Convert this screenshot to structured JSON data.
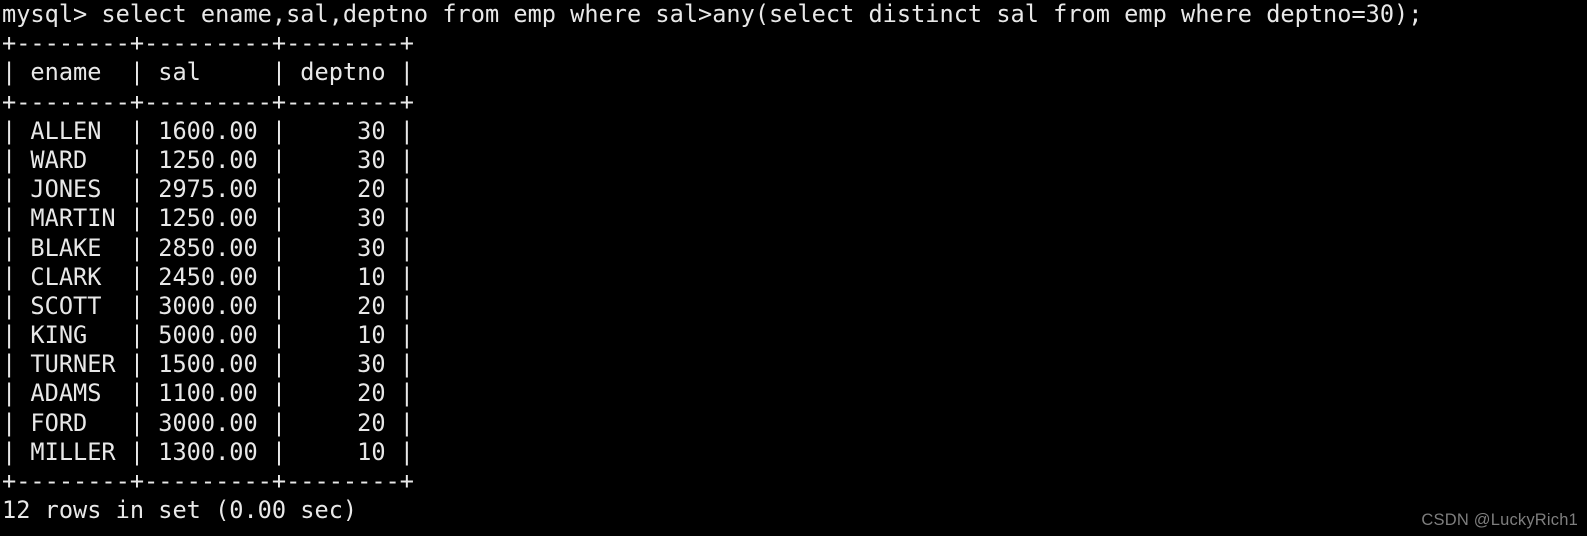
{
  "terminal": {
    "background_color": "#000000",
    "text_color": "#e8e8e8",
    "prompt": "mysql>",
    "query": "select ename,sal,deptno from emp where sal>any(select distinct sal from emp where deptno=30);",
    "command_line": "mysql> select ename,sal,deptno from emp where sal>any(select distinct sal from emp where deptno=30);",
    "status_line": "12 rows in set (0.00 sec)",
    "row_count": 12,
    "elapsed": "0.00 sec"
  },
  "result_table": {
    "border_line": "+--------+---------+--------+",
    "header_line": "| ename  | sal     | deptno |",
    "columns": [
      {
        "name": "ename",
        "width": 8,
        "align": "left"
      },
      {
        "name": "sal",
        "width": 9,
        "align": "left"
      },
      {
        "name": "deptno",
        "width": 8,
        "align": "right"
      }
    ],
    "rows": [
      {
        "ename": "ALLEN",
        "sal": "1600.00",
        "deptno": "30",
        "line": "| ALLEN  | 1600.00 |     30 |"
      },
      {
        "ename": "WARD",
        "sal": "1250.00",
        "deptno": "30",
        "line": "| WARD   | 1250.00 |     30 |"
      },
      {
        "ename": "JONES",
        "sal": "2975.00",
        "deptno": "20",
        "line": "| JONES  | 2975.00 |     20 |"
      },
      {
        "ename": "MARTIN",
        "sal": "1250.00",
        "deptno": "30",
        "line": "| MARTIN | 1250.00 |     30 |"
      },
      {
        "ename": "BLAKE",
        "sal": "2850.00",
        "deptno": "30",
        "line": "| BLAKE  | 2850.00 |     30 |"
      },
      {
        "ename": "CLARK",
        "sal": "2450.00",
        "deptno": "10",
        "line": "| CLARK  | 2450.00 |     10 |"
      },
      {
        "ename": "SCOTT",
        "sal": "3000.00",
        "deptno": "20",
        "line": "| SCOTT  | 3000.00 |     20 |"
      },
      {
        "ename": "KING",
        "sal": "5000.00",
        "deptno": "10",
        "line": "| KING   | 5000.00 |     10 |"
      },
      {
        "ename": "TURNER",
        "sal": "1500.00",
        "deptno": "30",
        "line": "| TURNER | 1500.00 |     30 |"
      },
      {
        "ename": "ADAMS",
        "sal": "1100.00",
        "deptno": "20",
        "line": "| ADAMS  | 1100.00 |     20 |"
      },
      {
        "ename": "FORD",
        "sal": "3000.00",
        "deptno": "20",
        "line": "| FORD   | 3000.00 |     20 |"
      },
      {
        "ename": "MILLER",
        "sal": "1300.00",
        "deptno": "10",
        "line": "| MILLER | 1300.00 |     10 |"
      }
    ]
  },
  "screen_lines": [
    "mysql> select ename,sal,deptno from emp where sal>any(select distinct sal from emp where deptno=30);",
    "+--------+---------+--------+",
    "| ename  | sal     | deptno |",
    "+--------+---------+--------+",
    "| ALLEN  | 1600.00 |     30 |",
    "| WARD   | 1250.00 |     30 |",
    "| JONES  | 2975.00 |     20 |",
    "| MARTIN | 1250.00 |     30 |",
    "| BLAKE  | 2850.00 |     30 |",
    "| CLARK  | 2450.00 |     10 |",
    "| SCOTT  | 3000.00 |     20 |",
    "| KING   | 5000.00 |     10 |",
    "| TURNER | 1500.00 |     30 |",
    "| ADAMS  | 1100.00 |     20 |",
    "| FORD   | 3000.00 |     20 |",
    "| MILLER | 1300.00 |     10 |",
    "+--------+---------+--------+",
    "12 rows in set (0.00 sec)"
  ],
  "watermark": {
    "text": "CSDN @LuckyRich1",
    "color": "#7e7e7e"
  }
}
